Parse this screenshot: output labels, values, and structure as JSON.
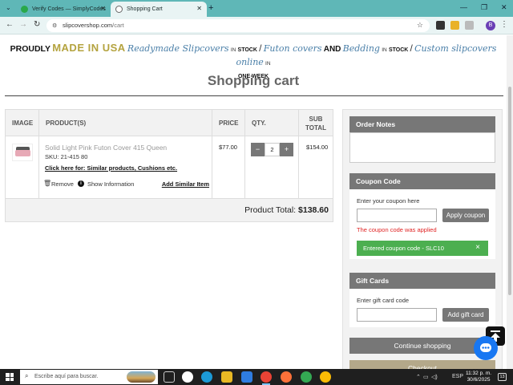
{
  "browser": {
    "tabs": [
      {
        "title": "Verify Codes — SimplyCodes",
        "active": false
      },
      {
        "title": "Shopping Cart",
        "active": true
      }
    ],
    "url_domain": "slipcovershop.com",
    "url_path": "/cart",
    "profile_initial": "B"
  },
  "banner": {
    "proudly": "PROUDLY",
    "made_in_usa": "MADE IN USA",
    "readymade": "Readymade Slipcovers",
    "in1": "IN",
    "stock1": "STOCK",
    "futon": "Futon covers",
    "and": "AND",
    "bedding": "Bedding",
    "in2": "IN",
    "stock2": "STOCK",
    "custom": "Custom slipcovers online",
    "in3": "IN",
    "one_week": "ONE WEEK"
  },
  "page_title": "Shopping cart",
  "table": {
    "headers": {
      "image": "IMAGE",
      "products": "PRODUCT(S)",
      "price": "PRICE",
      "qty": "QTY.",
      "subtotal_line1": "SUB",
      "subtotal_line2": "TOTAL"
    },
    "item": {
      "name": "Solid Light Pink Futon Cover 415 Queen",
      "sku": "SKU: 21-415 80",
      "similar_link": "Click here for: Similar products, Cushions etc.",
      "remove": "Remove",
      "show_info": "Show Information",
      "add_similar": "Add Similar Item",
      "price": "$77.00",
      "qty": "2",
      "subtotal": "$154.00",
      "minus": "−",
      "plus": "+"
    },
    "total_label": "Product Total:",
    "total_value": "$138.60"
  },
  "sidebar": {
    "order_notes_header": "Order Notes",
    "coupon_header": "Coupon Code",
    "coupon_label": "Enter your coupon here",
    "apply_coupon": "Apply coupon",
    "coupon_error": "The coupon code was applied",
    "coupon_alert": "Entered coupon code - SLC10",
    "gift_header": "Gift Cards",
    "gift_label": "Enter gift card code",
    "add_gift": "Add gift card",
    "continue": "Continue shopping",
    "checkout": "Checkout"
  },
  "taskbar": {
    "search_placeholder": "Escribe aquí para buscar.",
    "lang": "ESP",
    "time": "11:32 p. m.",
    "date": "30/6/2025",
    "notif_count": "13"
  },
  "colors": {
    "accent_gold": "#b4a33f",
    "link_blue": "#4a7fa8",
    "button_gray": "#777777",
    "success_green": "#4caf50",
    "error_red": "#e02424",
    "chat_blue": "#1877f2"
  }
}
